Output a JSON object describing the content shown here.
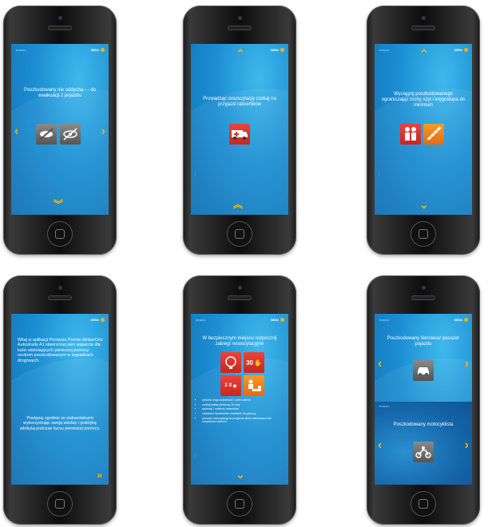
{
  "brand_label": "POMOC",
  "menu_label": "MENU",
  "phones": {
    "p1": {
      "message": "Poszkodowany nie oddycha - - do ewakuacji z pojazdu"
    },
    "p2": {
      "message": "Prowadząc resuscytację czekaj na przyjazd ratowników"
    },
    "p3": {
      "message": "Wyciągnij poszkodowanego ograniczając ruchy szyi i kręgosłupa do minimum"
    },
    "p4": {
      "paragraph1": "Witaj w aplikacji Pierwsza Pomoc AmberOne Autostrady A1 stworzonej jako wsparcie dla ludzi udzielających pierwszej pomocy osobom poszkodowanym w wypadkach drogowych.",
      "paragraph2": "Postępuj zgodnie ze wskazówkami wykorzystując swoją wiedzę i praktykę zdobytą podczas kursu pierwszej pomocy."
    },
    "p5": {
      "message": "W bezpiecznym miejscu rozpocznij zabiegi resuscytacyjne",
      "tile_30": "30",
      "tile_2x": "2 X",
      "steps": [
        "udrożnij drogi oddechowe i oceń oddech",
        "uciskaj klatkę piersiową 30 razy",
        "wykonaj 2 oddechy ratownicze",
        "zawiadom kwadrukiem zdarzenie do pomocy",
        "prowadź resuscytację do przyjazdu służb ratunkowych lub odzyskania oddechu"
      ]
    },
    "p6": {
      "message_top": "Poszkodowany kierowca/ pasażer pojazdu",
      "message_bottom": "Poszkodowany motocyklista"
    }
  },
  "icons": {
    "left_arrow": "‹",
    "right_arrow": "›",
    "up_arrow": "⌃",
    "down_arrow": "⌄",
    "chevron_down_triple": "︾",
    "chevron_up_triple": "︽",
    "chevron_right_triple": "»"
  },
  "colors": {
    "accent": "#f4b400",
    "screen_blue": "#1c8fd2",
    "tile_red": "#d8322a",
    "tile_orange": "#f08a1f",
    "tile_gray": "#6e6e6e"
  }
}
